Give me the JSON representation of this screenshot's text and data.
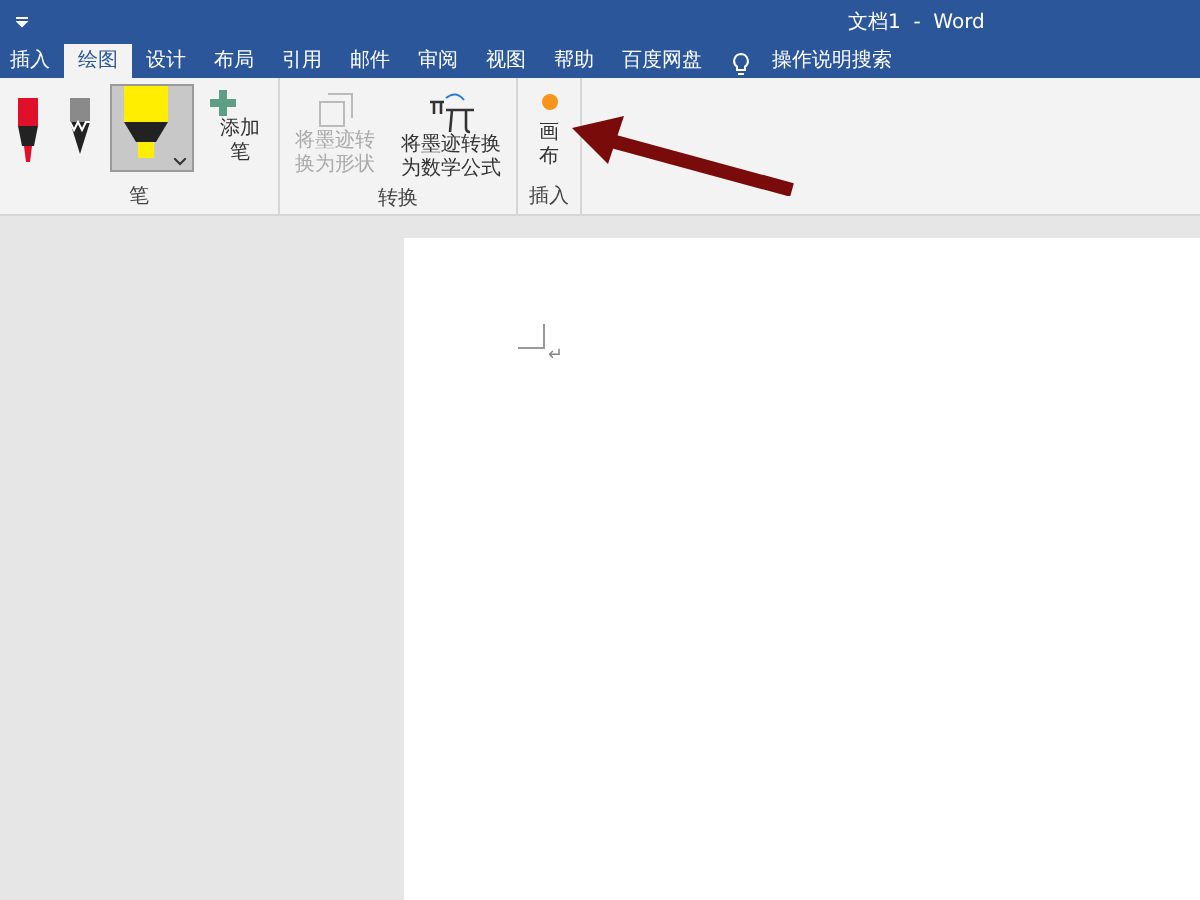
{
  "window": {
    "title": "文档1  -  Word"
  },
  "tabs": [
    {
      "label": "插入",
      "selected": false
    },
    {
      "label": "绘图",
      "selected": true
    },
    {
      "label": "设计",
      "selected": false
    },
    {
      "label": "布局",
      "selected": false
    },
    {
      "label": "引用",
      "selected": false
    },
    {
      "label": "邮件",
      "selected": false
    },
    {
      "label": "审阅",
      "selected": false
    },
    {
      "label": "视图",
      "selected": false
    },
    {
      "label": "帮助",
      "selected": false
    },
    {
      "label": "百度网盘",
      "selected": false
    }
  ],
  "tell_me": {
    "label": "操作说明搜索"
  },
  "ribbon": {
    "groups": [
      {
        "label": "笔",
        "items": [
          {
            "kind": "pen",
            "selected": false
          },
          {
            "kind": "pencil",
            "selected": false
          },
          {
            "kind": "highlighter",
            "selected": true
          },
          {
            "kind": "add",
            "label": "添加笔",
            "disabled": false
          }
        ]
      },
      {
        "label": "转换",
        "items": [
          {
            "kind": "shape",
            "label": "将墨迹转换为形状",
            "disabled": true
          },
          {
            "kind": "math",
            "label": "将墨迹转换为数学公式",
            "disabled": false
          }
        ]
      },
      {
        "label": "插入",
        "items": [
          {
            "kind": "canvas",
            "label": "画布",
            "disabled": false
          }
        ]
      }
    ]
  },
  "document": {
    "paragraph_mark": "↵"
  }
}
